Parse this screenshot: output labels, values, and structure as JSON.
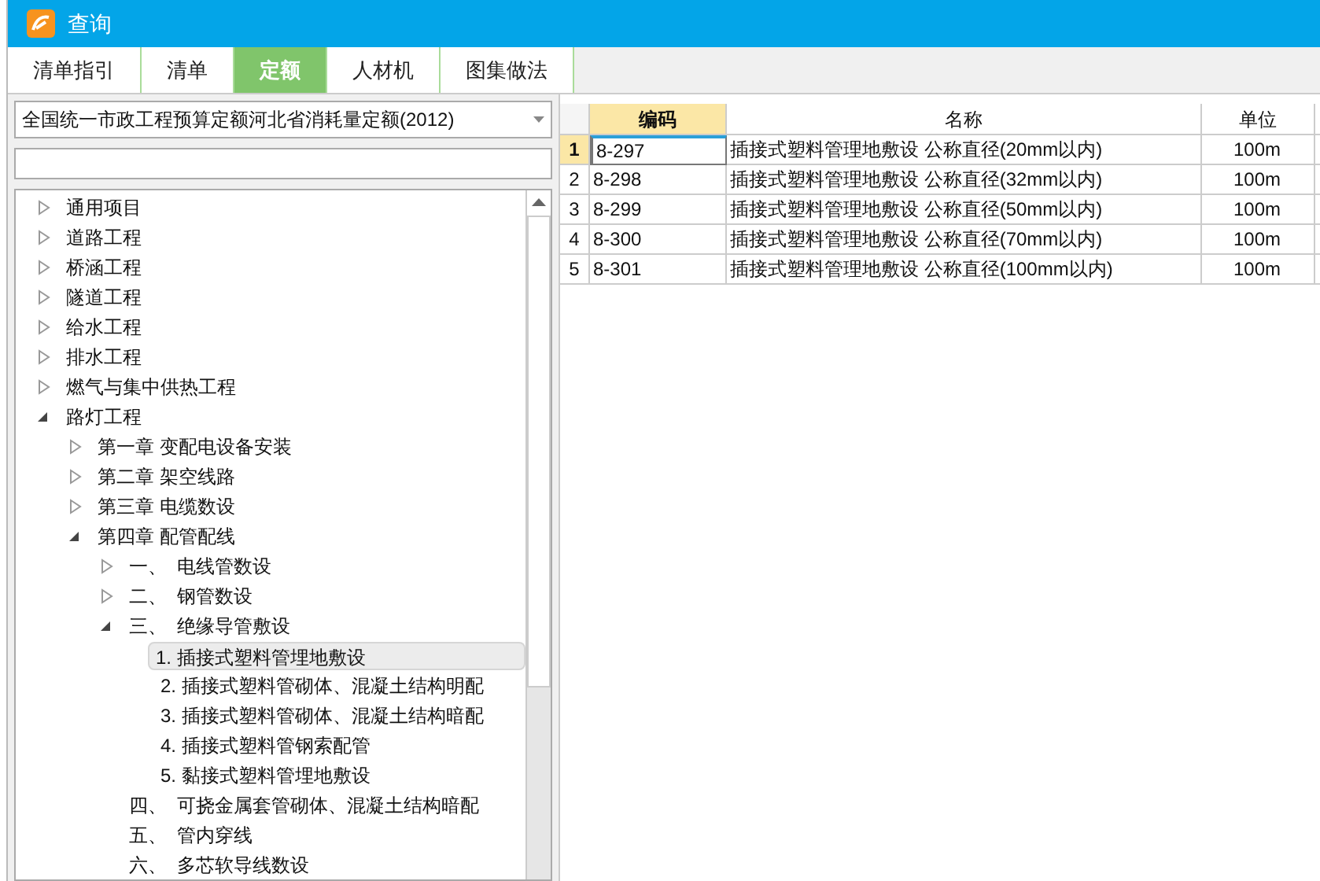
{
  "window": {
    "title": "查询"
  },
  "tabs": [
    {
      "label": "清单指引",
      "selected": false
    },
    {
      "label": "清单",
      "selected": false
    },
    {
      "label": "定额",
      "selected": true
    },
    {
      "label": "人材机",
      "selected": false
    },
    {
      "label": "图集做法",
      "selected": false
    }
  ],
  "library_select": {
    "value": "全国统一市政工程预算定额河北省消耗量定额(2012)"
  },
  "tree": [
    {
      "label": "通用项目",
      "expanded": false,
      "selected": false
    },
    {
      "label": "道路工程",
      "expanded": false,
      "selected": false
    },
    {
      "label": "桥涵工程",
      "expanded": false,
      "selected": false
    },
    {
      "label": "隧道工程",
      "expanded": false,
      "selected": false
    },
    {
      "label": "给水工程",
      "expanded": false,
      "selected": false
    },
    {
      "label": "排水工程",
      "expanded": false,
      "selected": false
    },
    {
      "label": "燃气与集中供热工程",
      "expanded": false,
      "selected": false
    },
    {
      "label": "路灯工程",
      "expanded": true,
      "selected": false,
      "children": [
        {
          "label": "第一章 变配电设备安装",
          "expanded": false,
          "selected": false
        },
        {
          "label": "第二章 架空线路",
          "expanded": false,
          "selected": false
        },
        {
          "label": "第三章 电缆数设",
          "expanded": false,
          "selected": false
        },
        {
          "label": "第四章 配管配线",
          "expanded": true,
          "selected": false,
          "children": [
            {
              "label": "一、  电线管数设",
              "expanded": false,
              "selected": false
            },
            {
              "label": "二、  钢管数设",
              "expanded": false,
              "selected": false
            },
            {
              "label": "三、  绝缘导管敷设",
              "expanded": true,
              "selected": false,
              "children": [
                {
                  "label": "1. 插接式塑料管埋地敷设",
                  "selected": true
                },
                {
                  "label": "2. 插接式塑料管砌体、混凝土结构明配",
                  "selected": false
                },
                {
                  "label": "3. 插接式塑料管砌体、混凝土结构暗配",
                  "selected": false
                },
                {
                  "label": "4. 插接式塑料管钢索配管",
                  "selected": false
                },
                {
                  "label": "5. 黏接式塑料管埋地敷设",
                  "selected": false
                }
              ]
            },
            {
              "label": "四、  可挠金属套管砌体、混凝土结构暗配",
              "selected": false
            },
            {
              "label": "五、  管内穿线",
              "selected": false
            },
            {
              "label": "六、  多芯软导线数设",
              "selected": false
            }
          ]
        }
      ]
    }
  ],
  "table": {
    "columns": [
      "编码",
      "名称",
      "单位"
    ],
    "rows": [
      {
        "number": "1",
        "code": "8-297",
        "name": "插接式塑料管理地敷设 公称直径(20mm以内)",
        "unit": "100m",
        "selected": true
      },
      {
        "number": "2",
        "code": "8-298",
        "name": "插接式塑料管理地敷设 公称直径(32mm以内)",
        "unit": "100m",
        "selected": false
      },
      {
        "number": "3",
        "code": "8-299",
        "name": "插接式塑料管理地敷设 公称直径(50mm以内)",
        "unit": "100m",
        "selected": false
      },
      {
        "number": "4",
        "code": "8-300",
        "name": "插接式塑料管理地敷设 公称直径(70mm以内)",
        "unit": "100m",
        "selected": false
      },
      {
        "number": "5",
        "code": "8-301",
        "name": "插接式塑料管理地敷设 公称直径(100mm以内)",
        "unit": "100m",
        "selected": false
      }
    ]
  }
}
